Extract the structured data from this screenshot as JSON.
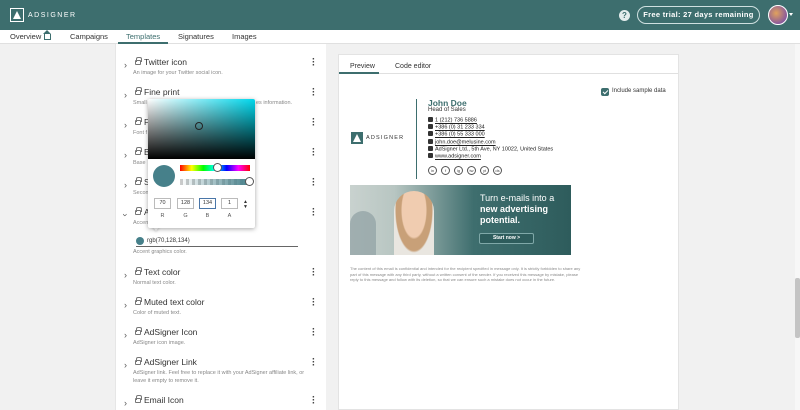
{
  "app": {
    "brand": "ADSIGNER",
    "help_label": "?",
    "trial_label": "Free trial: 27 days remaining"
  },
  "nav": {
    "overview": "Overview",
    "campaigns": "Campaigns",
    "templates": "Templates",
    "signatures": "Signatures",
    "images": "Images"
  },
  "settings": {
    "items": [
      {
        "title": "Twitter icon",
        "desc": "An image for your Twitter social icon."
      },
      {
        "title": "Fine print",
        "desc": "Small",
        "desc_tail": "es information."
      },
      {
        "title": "F",
        "desc": "Font f"
      },
      {
        "title": "B",
        "desc": "Base"
      },
      {
        "title": "S",
        "desc": "Secon"
      },
      {
        "title": "A",
        "desc": "Accen"
      },
      {
        "title": "Text color",
        "desc": "Normal text color."
      },
      {
        "title": "Muted text color",
        "desc": "Color of muted text."
      },
      {
        "title": "AdSigner Icon",
        "desc": "AdSigner icon image."
      },
      {
        "title": "AdSigner Link",
        "desc": "AdSigner link. Feel free to replace it with your AdSigner affiliate link, or",
        "desc2": "leave it empty to remove it."
      },
      {
        "title": "Email Icon",
        "desc": ""
      }
    ],
    "accent_value": "rgb(70,128,134)",
    "accent_helper": "Accent graphics color."
  },
  "picker": {
    "color": "#46808a",
    "channels": [
      {
        "label": "R",
        "value": "70"
      },
      {
        "label": "G",
        "value": "128"
      },
      {
        "label": "B",
        "value": "134"
      },
      {
        "label": "A",
        "value": "1"
      }
    ]
  },
  "preview": {
    "tabs": {
      "preview": "Preview",
      "code": "Code editor"
    },
    "sample_label": "Include sample data",
    "signature": {
      "name": "John Doe",
      "role": "Head of Sales",
      "phone1": "1 (212) 736 5886",
      "phone2": "+386 (0) 31 233 334",
      "phone3": "+386 (0) 55 333 000",
      "email": "john.doe@melusine.com",
      "address": "AdSigner Ltd.,   5th Ave, NY 10022, United States",
      "website": "www.adsigner.com",
      "logo_text": "ADSIGNER",
      "socials": [
        "in",
        "f",
        "ig",
        "tw",
        "yt",
        "ds"
      ]
    },
    "banner": {
      "line1": "Turn e-mails into a",
      "line2": "new advertising",
      "line3": "potential.",
      "button": "Start now >"
    },
    "disclaimer": "The content of this email is confidential and intended for the recipient specified in message only. It is strictly forbidden to share any part of this message with any third party, without a written consent of the sender. If you received this message by mistake, please reply to this message and follow with its deletion, so that we can ensure such a mistake does not occur in the future."
  }
}
